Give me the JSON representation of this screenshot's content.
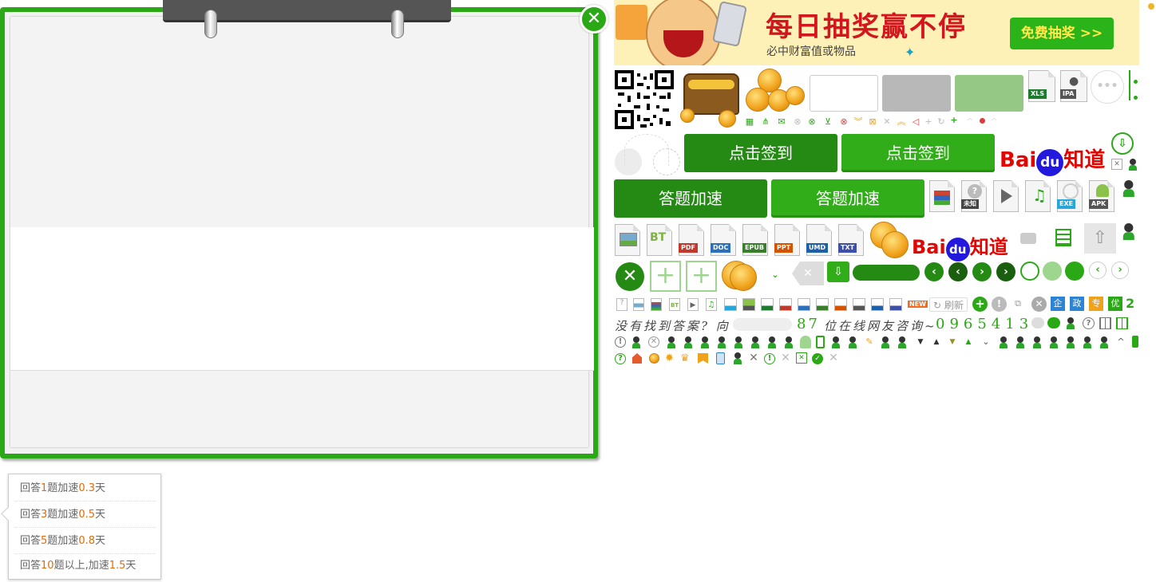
{
  "banner": {
    "title": "每日抽奖赢不停",
    "subtitle": "必中财富值或物品",
    "button_label": "免费抽奖 >>"
  },
  "buttons": {
    "sign_in_dark": "点击签到",
    "sign_in_light": "点击签到",
    "speed_dark": "答题加速",
    "speed_light": "答题加速"
  },
  "baidu": {
    "bai": "Bai",
    "du": "du",
    "zhidao": "知道"
  },
  "file_tags": {
    "xls": "XLS",
    "ipa": "IPA",
    "unknown": "未知",
    "exe": "EXE",
    "apk": "APK",
    "bt": "BT",
    "pdf": "PDF",
    "doc": "DOC",
    "epub": "EPUB",
    "ppt": "PPT",
    "umd": "UMD",
    "txt": "TXT"
  },
  "small_row": {
    "new": "NEW",
    "refresh": "刷新",
    "badges": [
      "企",
      "政",
      "专",
      "优"
    ],
    "digit": "2"
  },
  "not_found_text": "没有找到答案? 向",
  "consult_number": "87",
  "consult_text": "位在线网友咨询~",
  "digits": "0965413",
  "tooltip": {
    "rows": [
      {
        "pre": "回答",
        "n": "1",
        "mid": "题加速",
        "v": "0.3",
        "post": "天"
      },
      {
        "pre": "回答",
        "n": "3",
        "mid": "题加速",
        "v": "0.5",
        "post": "天"
      },
      {
        "pre": "回答",
        "n": "5",
        "mid": "题加速",
        "v": "0.8",
        "post": "天"
      },
      {
        "pre": "回答",
        "n": "10",
        "mid": "题以上,加速",
        "v": "1.5",
        "post": "天"
      }
    ]
  },
  "colors": {
    "green": "#2aa815",
    "dark_green": "#248a13",
    "orange_number": "#e06c0b",
    "baidu_red": "#e10602",
    "baidu_blue": "#2319dc"
  }
}
